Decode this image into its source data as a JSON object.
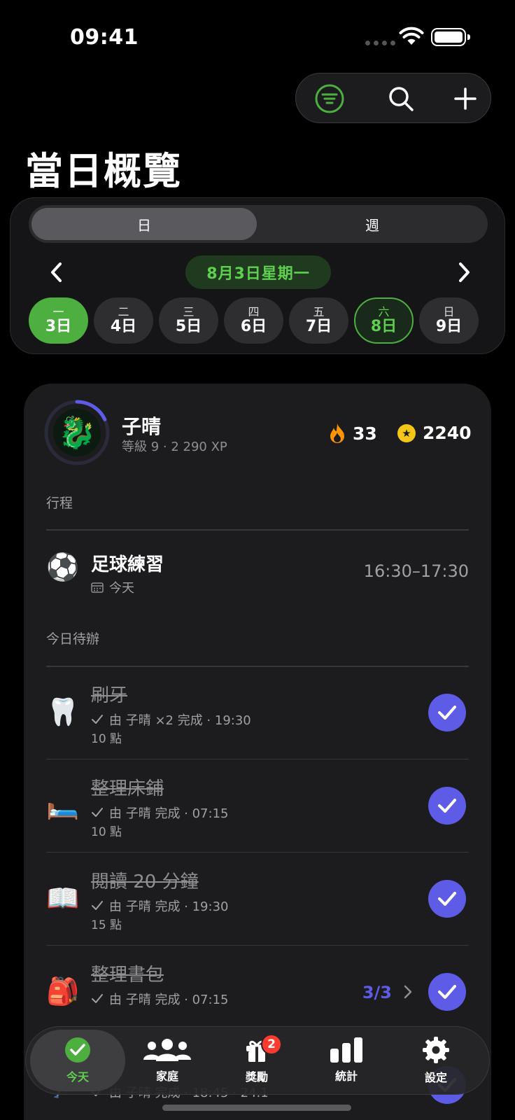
{
  "status": {
    "time": "09:41"
  },
  "toolbar": {
    "filter_icon": "filter-icon",
    "search_icon": "search-icon",
    "add_icon": "plus-icon"
  },
  "page_title": "當日概覽",
  "calendar": {
    "segments": {
      "day": "日",
      "week": "週"
    },
    "current_date": "8月3日星期一",
    "days": [
      {
        "name": "一",
        "date": "3日"
      },
      {
        "name": "二",
        "date": "4日"
      },
      {
        "name": "三",
        "date": "5日"
      },
      {
        "name": "四",
        "date": "6日"
      },
      {
        "name": "五",
        "date": "7日"
      },
      {
        "name": "六",
        "date": "8日"
      },
      {
        "name": "日",
        "date": "9日"
      }
    ]
  },
  "user": {
    "name": "子晴",
    "level": "等級 9 · 2 290 XP",
    "avatar": "🐉",
    "level_progress": 0.18,
    "streak": "33",
    "coins": "2240"
  },
  "sections": {
    "schedule": "行程",
    "todo": "今日待辦"
  },
  "event": {
    "icon": "⚽",
    "title": "足球練習",
    "when": "今天",
    "time": "16:30–17:30"
  },
  "tasks": [
    {
      "icon": "🦷",
      "title": "刷牙",
      "by": "由 子晴 ×2 完成 · 19:30",
      "points": "10 點"
    },
    {
      "icon": "🛏️",
      "title": "整理床鋪",
      "by": "由 子晴 完成 · 07:15",
      "points": "10 點"
    },
    {
      "icon": "📖",
      "title": "閱讀 20 分鐘",
      "by": "由 子晴 完成 · 19:30",
      "points": "15 點"
    },
    {
      "icon": "🎒",
      "title": "整理書包",
      "by": "由 子晴 完成 · 07:15",
      "progress": "3/3"
    },
    {
      "icon": "🏃",
      "title": "",
      "by": "由 子晴 完成 · 18:45 · 24.1"
    }
  ],
  "tabbar": {
    "items": [
      {
        "label": "今天",
        "icon": "check-circle-icon"
      },
      {
        "label": "家庭",
        "icon": "people-icon"
      },
      {
        "label": "獎勵",
        "icon": "gift-icon",
        "badge": "2"
      },
      {
        "label": "統計",
        "icon": "bar-chart-icon"
      },
      {
        "label": "設定",
        "icon": "gear-icon"
      }
    ]
  },
  "colors": {
    "accent_green": "#4caf3f",
    "accent_purple": "#5e5ce6",
    "badge_red": "#ff3b30",
    "coin_yellow": "#f5c518",
    "streak_orange": "#ff9500"
  }
}
